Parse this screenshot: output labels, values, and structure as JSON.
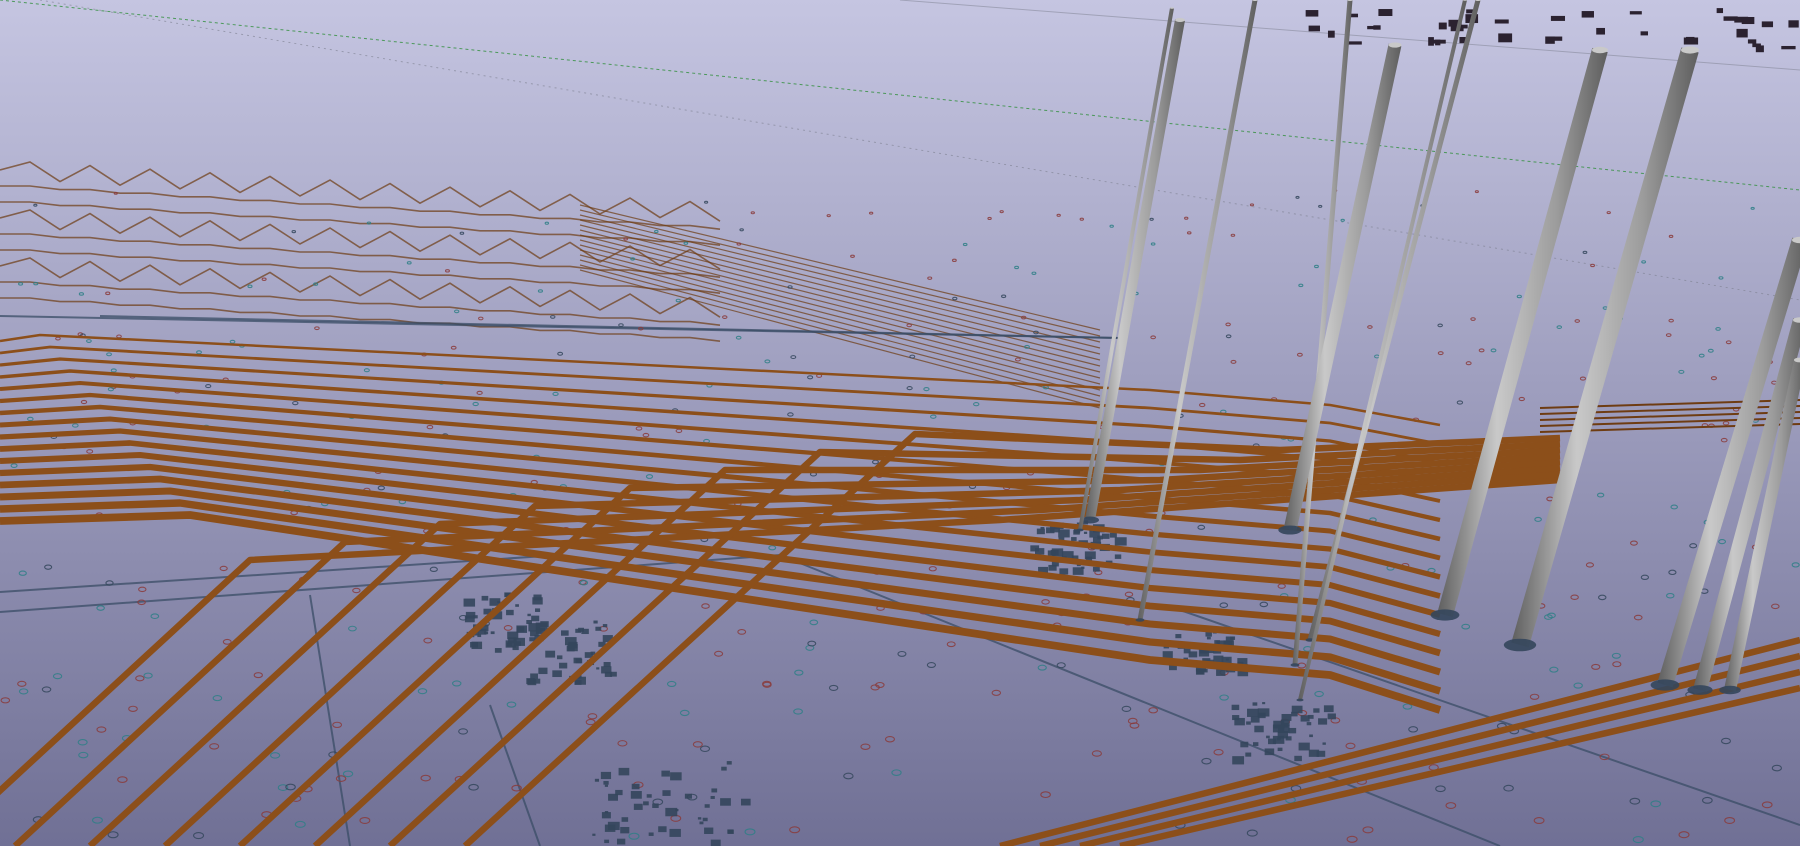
{
  "app": {
    "view": "3D PCB viewer",
    "visible_text": []
  },
  "scene": {
    "background_top": "#c5c5e1",
    "background_bottom": "#707095",
    "colors": {
      "copper_trace": "#8c4f1a",
      "copper_trace_dark": "#6e3c12",
      "pad_dark": "#34465c",
      "silkscreen_blue": "#3a4d66",
      "via_teal": "#2e7f86",
      "via_red": "#8a3b3b",
      "ratsnest_green": "#2f8f3a",
      "ratsnest_gray": "#7d8090",
      "pin_metal_light": "#c9c9c9",
      "pin_metal_mid": "#9c9c9c",
      "pin_metal_dark": "#5e5e5e"
    },
    "elements": [
      "copper-traces",
      "through-hole-pins",
      "smd-pads",
      "vias",
      "ratsnest-lines",
      "board-outline"
    ]
  }
}
